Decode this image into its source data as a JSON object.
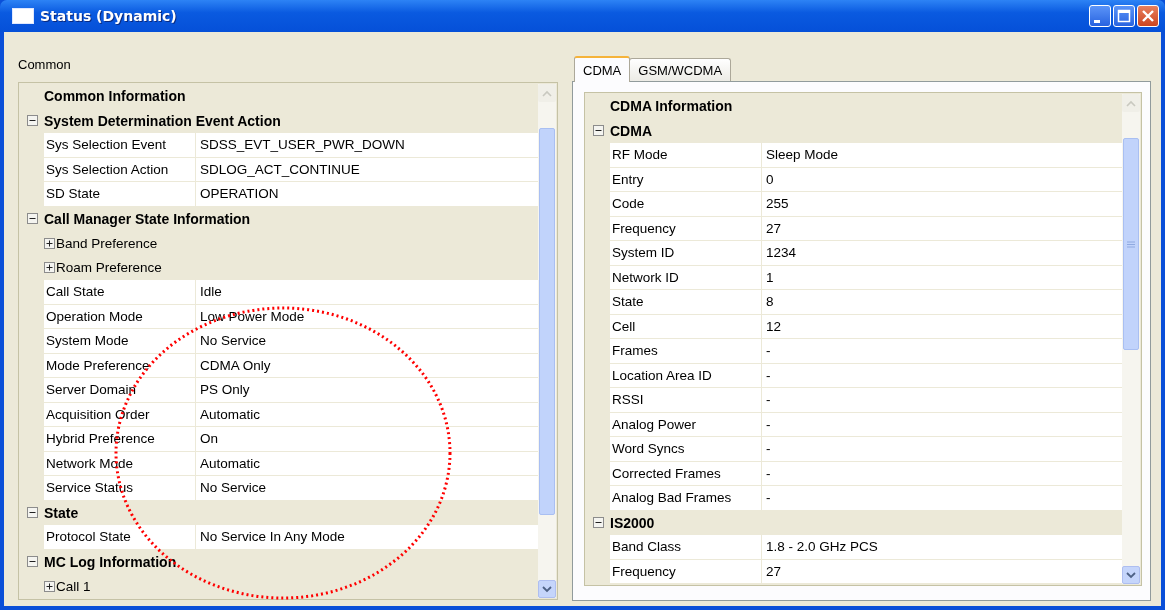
{
  "window": {
    "title": "Status (Dynamic)"
  },
  "common": {
    "label": "Common",
    "grid": {
      "title": "Common Information",
      "categories": [
        {
          "title": "System Determination Event Action",
          "expanded": true,
          "children": [
            {
              "kind": "property",
              "name": "Sys Selection Event",
              "value": "SDSS_EVT_USER_PWR_DOWN"
            },
            {
              "kind": "property",
              "name": "Sys Selection Action",
              "value": "SDLOG_ACT_CONTINUE"
            },
            {
              "kind": "property",
              "name": "SD State",
              "value": "OPERATION"
            }
          ]
        },
        {
          "title": "Call Manager State Information",
          "expanded": true,
          "children": [
            {
              "kind": "expandable",
              "name": "Band Preference",
              "expanded": false
            },
            {
              "kind": "expandable",
              "name": "Roam Preference",
              "expanded": false
            },
            {
              "kind": "property",
              "name": "Call State",
              "value": "Idle"
            },
            {
              "kind": "property",
              "name": "Operation Mode",
              "value": "Low Power Mode"
            },
            {
              "kind": "property",
              "name": "System Mode",
              "value": "No Service"
            },
            {
              "kind": "property",
              "name": "Mode Preference",
              "value": "CDMA Only"
            },
            {
              "kind": "property",
              "name": "Server Domain",
              "value": "PS Only"
            },
            {
              "kind": "property",
              "name": "Acquisition Order",
              "value": "Automatic"
            },
            {
              "kind": "property",
              "name": "Hybrid Preference",
              "value": "On"
            },
            {
              "kind": "property",
              "name": "Network Mode",
              "value": "Automatic"
            },
            {
              "kind": "property",
              "name": "Service Status",
              "value": "No Service"
            }
          ]
        },
        {
          "title": "State",
          "expanded": true,
          "children": [
            {
              "kind": "property",
              "name": "Protocol State",
              "value": "No Service In Any Mode"
            }
          ]
        },
        {
          "title": "MC Log Information",
          "expanded": true,
          "children": [
            {
              "kind": "expandable",
              "name": "Call 1",
              "expanded": false
            }
          ]
        }
      ]
    }
  },
  "tabs": [
    {
      "label": "CDMA",
      "selected": true
    },
    {
      "label": "GSM/WCDMA",
      "selected": false
    }
  ],
  "cdma": {
    "grid": {
      "title": "CDMA Information",
      "categories": [
        {
          "title": "CDMA",
          "expanded": true,
          "children": [
            {
              "kind": "property",
              "name": "RF Mode",
              "value": "Sleep Mode"
            },
            {
              "kind": "property",
              "name": "Entry",
              "value": "0"
            },
            {
              "kind": "property",
              "name": "Code",
              "value": "255"
            },
            {
              "kind": "property",
              "name": "Frequency",
              "value": "27"
            },
            {
              "kind": "property",
              "name": "System ID",
              "value": "1234"
            },
            {
              "kind": "property",
              "name": "Network ID",
              "value": "1"
            },
            {
              "kind": "property",
              "name": "State",
              "value": "8"
            },
            {
              "kind": "property",
              "name": "Cell",
              "value": "12"
            },
            {
              "kind": "property",
              "name": "Frames",
              "value": "-"
            },
            {
              "kind": "property",
              "name": "Location Area ID",
              "value": "-"
            },
            {
              "kind": "property",
              "name": "RSSI",
              "value": "-"
            },
            {
              "kind": "property",
              "name": "Analog Power",
              "value": "-"
            },
            {
              "kind": "property",
              "name": "Word Syncs",
              "value": "-"
            },
            {
              "kind": "property",
              "name": "Corrected Frames",
              "value": "-"
            },
            {
              "kind": "property",
              "name": "Analog Bad Frames",
              "value": "-"
            }
          ]
        },
        {
          "title": "IS2000",
          "expanded": true,
          "children": [
            {
              "kind": "property",
              "name": "Band Class",
              "value": "1.8 - 2.0 GHz PCS"
            },
            {
              "kind": "property",
              "name": "Frequency",
              "value": "27"
            }
          ]
        }
      ]
    }
  }
}
